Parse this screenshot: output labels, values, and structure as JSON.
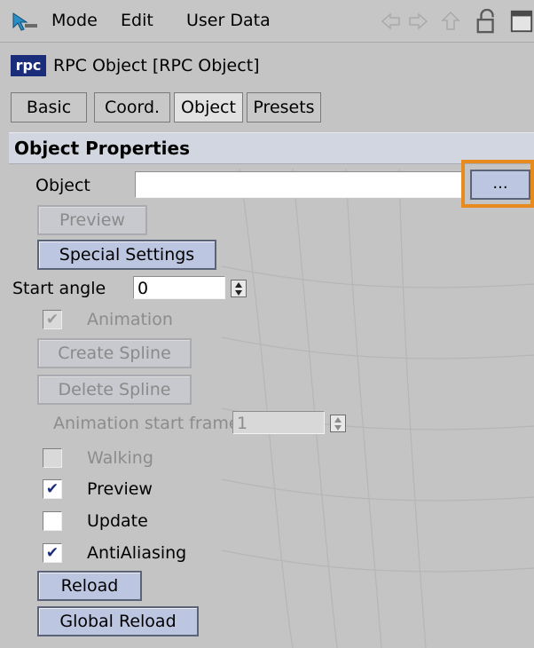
{
  "menu": {
    "mode": "Mode",
    "edit": "Edit",
    "user_data": "User Data"
  },
  "header": {
    "logo_text": "rpc",
    "title": "RPC Object [RPC Object]"
  },
  "tabs": [
    {
      "label": "Basic",
      "active": false
    },
    {
      "label": "Coord.",
      "active": false
    },
    {
      "label": "Object",
      "active": true
    },
    {
      "label": "Presets",
      "active": false
    }
  ],
  "section": {
    "title": "Object Properties"
  },
  "object_field": {
    "label": "Object",
    "value": "",
    "browse_label": "..."
  },
  "buttons": {
    "preview": "Preview",
    "special_settings": "Special Settings",
    "create_spline": "Create Spline",
    "delete_spline": "Delete Spline",
    "reload": "Reload",
    "global_reload": "Global Reload"
  },
  "start_angle": {
    "label": "Start angle",
    "value": "0"
  },
  "animation_start_frame": {
    "label": "Animation start frame",
    "value": "1"
  },
  "checkboxes": {
    "animation": {
      "label": "Animation",
      "checked": true,
      "enabled": false
    },
    "walking": {
      "label": "Walking",
      "checked": false,
      "enabled": false
    },
    "preview": {
      "label": "Preview",
      "checked": true,
      "enabled": true
    },
    "update": {
      "label": "Update",
      "checked": false,
      "enabled": true
    },
    "antialiasing": {
      "label": "AntiAliasing",
      "checked": true,
      "enabled": true
    }
  },
  "colors": {
    "panel_bg": "#c4c4c4",
    "button_bg": "#bdc6e0",
    "highlight": "#e88b1f",
    "logo_bg": "#1b2d7a"
  }
}
